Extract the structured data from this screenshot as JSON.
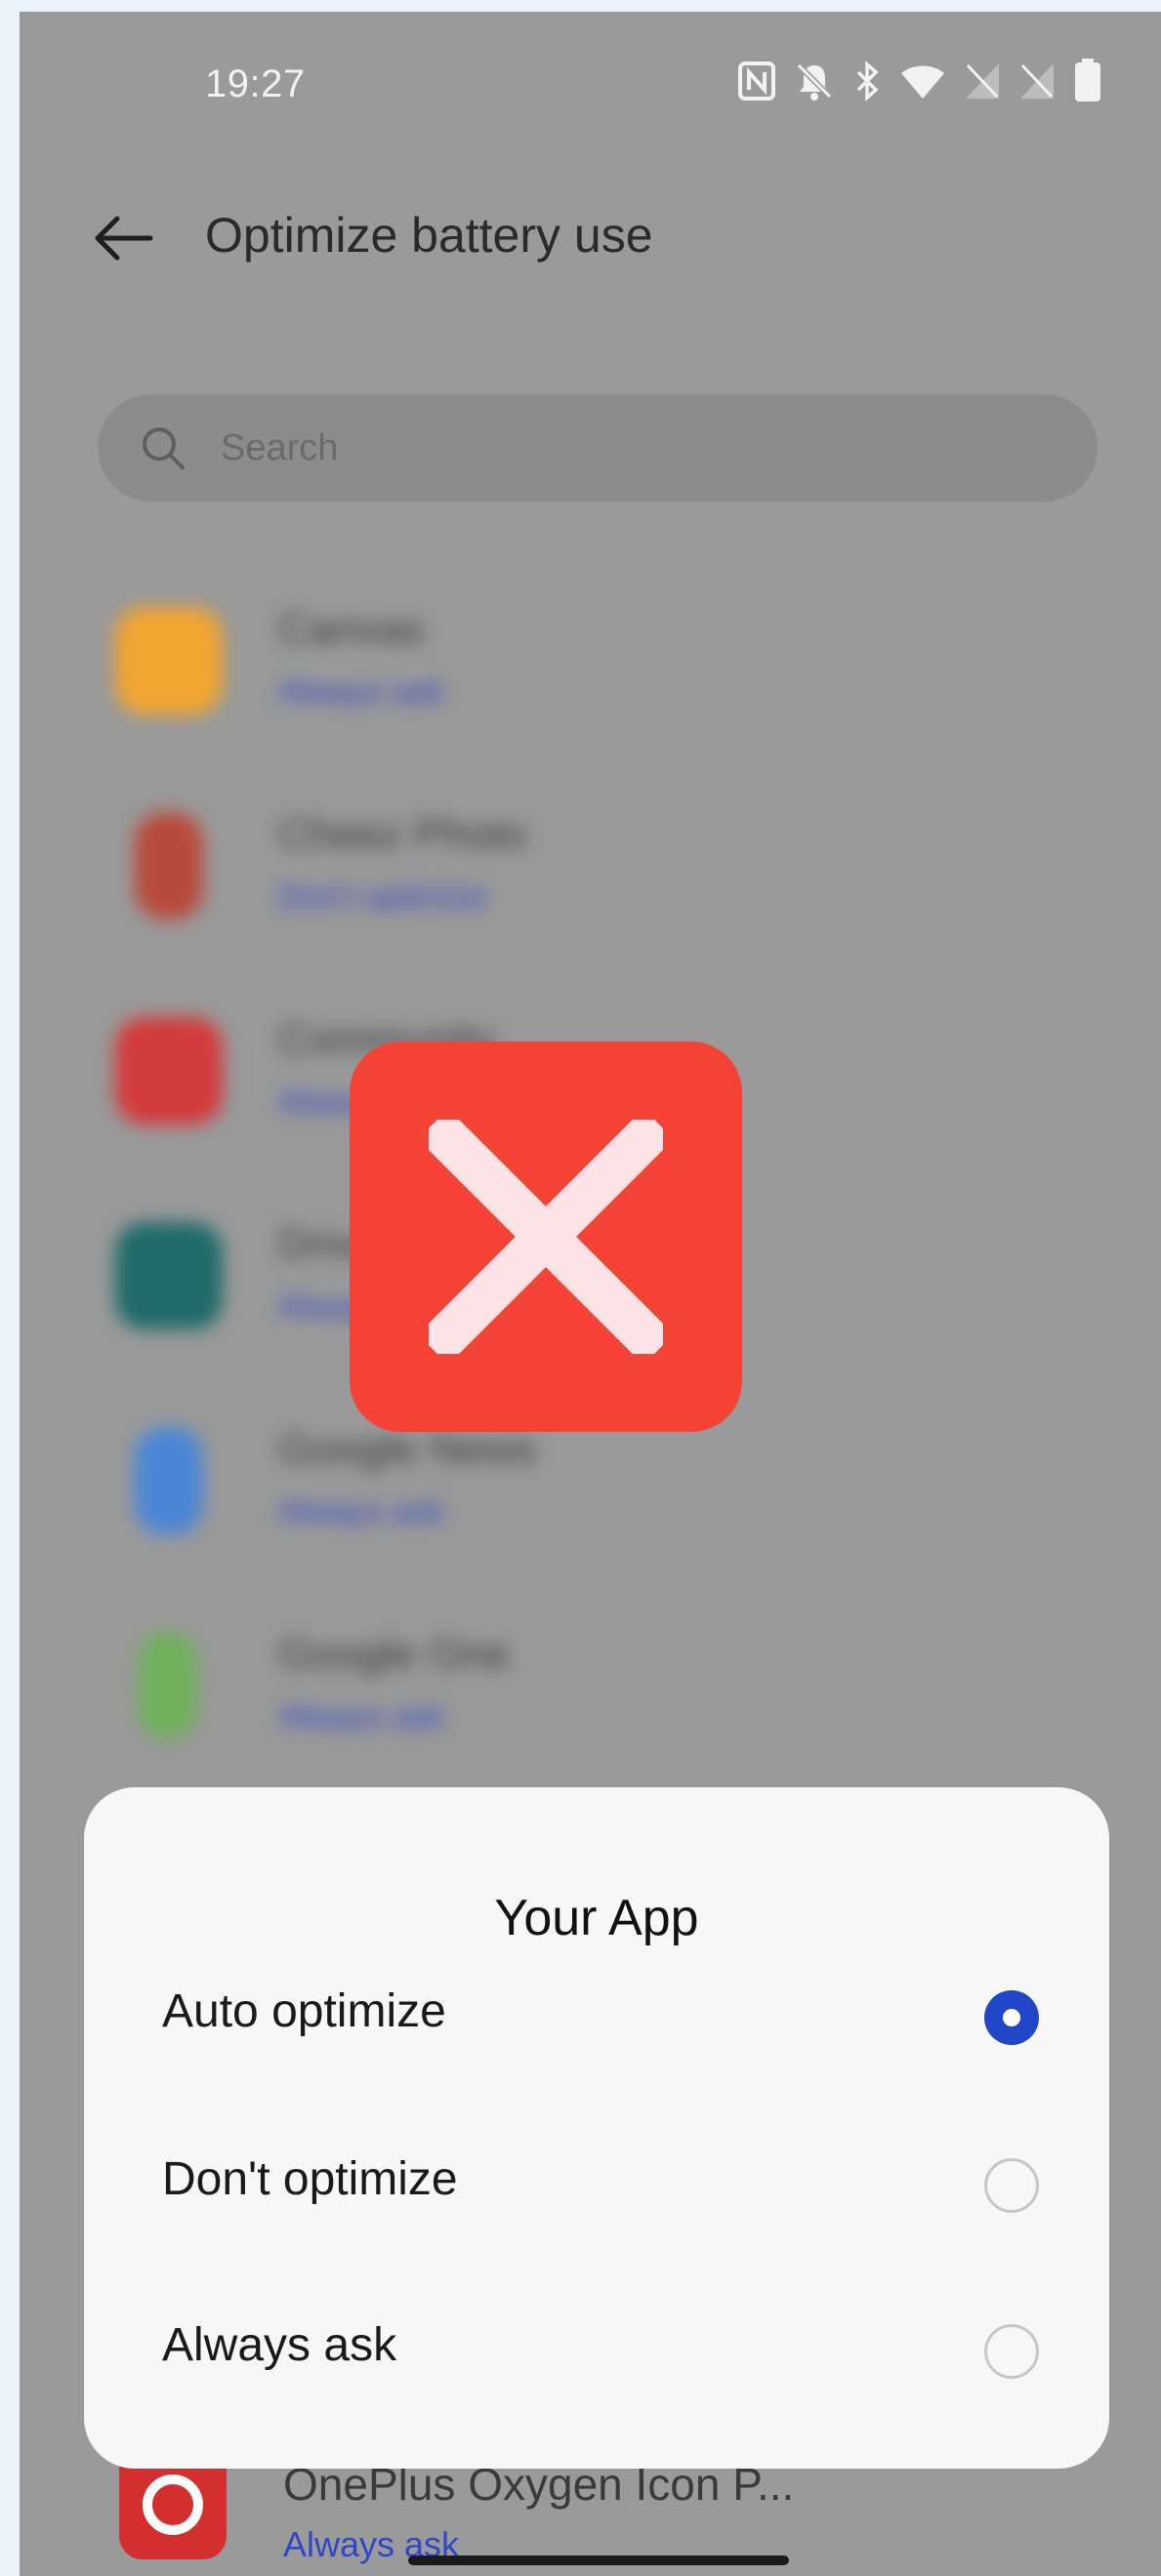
{
  "status_bar": {
    "time": "19:27",
    "icons": [
      "nfc-icon",
      "bell-off-icon",
      "bluetooth-icon",
      "wifi-icon",
      "no-sim-icon",
      "no-sim-icon",
      "battery-icon"
    ]
  },
  "header": {
    "back_icon": "arrow-left-icon",
    "title": "Optimize battery use"
  },
  "search": {
    "icon": "search-icon",
    "placeholder": "Search"
  },
  "app_list": [
    {
      "name": "Canvas",
      "status": "Always ask",
      "icon_color": "#f2a530"
    },
    {
      "name": "Cheez Photo",
      "status": "Don't optimize",
      "icon_color": "#b84a3a"
    },
    {
      "name": "Community",
      "status": "Always ask",
      "icon_color": "#d33a3a"
    },
    {
      "name": "Drive",
      "status": "Always ask",
      "icon_color": "#1f6a6a"
    },
    {
      "name": "Google News",
      "status": "Always ask",
      "icon_color": "#4a86d6"
    },
    {
      "name": "Google One",
      "status": "Always ask",
      "icon_color": "#6fb05a"
    }
  ],
  "error_overlay": {
    "icon": "close-icon",
    "color": "#f44336"
  },
  "dialog": {
    "title": "Your App",
    "options": [
      {
        "label": "Auto optimize",
        "selected": true
      },
      {
        "label": "Don't optimize",
        "selected": false
      },
      {
        "label": "Always ask",
        "selected": false
      }
    ],
    "accent": "#2146c7"
  },
  "bottom_app": {
    "name": "OnePlus Oxygen Icon P...",
    "status": "Always ask"
  }
}
